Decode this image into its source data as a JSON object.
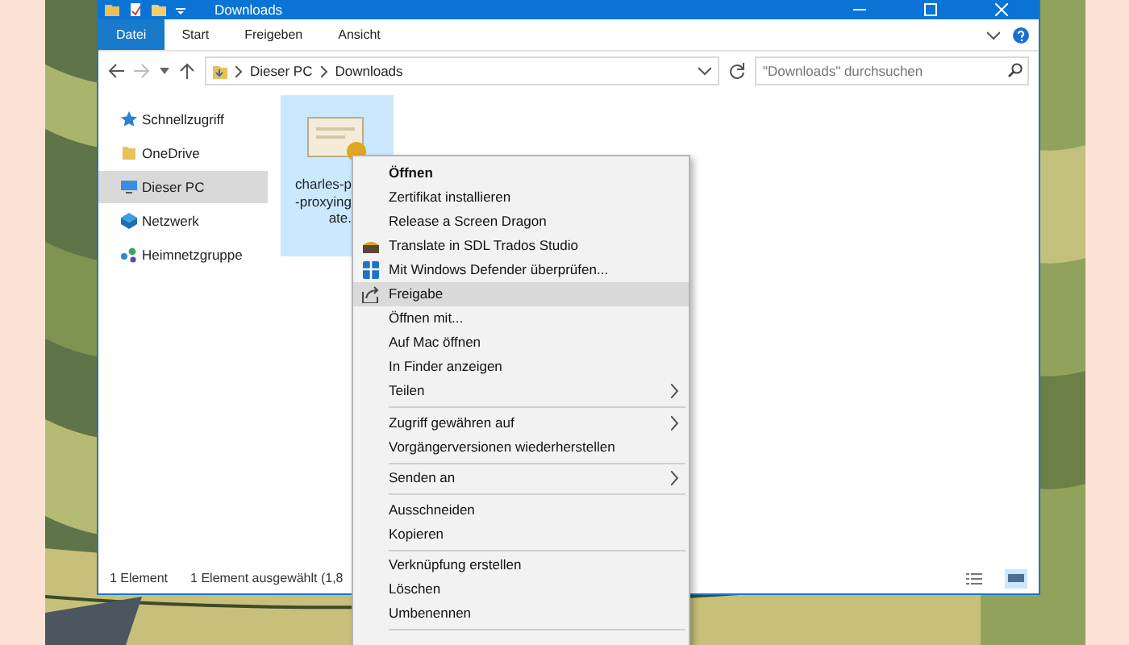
{
  "window": {
    "title": "Downloads"
  },
  "ribbon_tabs": [
    {
      "label": "Datei",
      "selected": true
    },
    {
      "label": "Start",
      "selected": false
    },
    {
      "label": "Freigeben",
      "selected": false
    },
    {
      "label": "Ansicht",
      "selected": false
    }
  ],
  "address_bar": {
    "path": [
      "Dieser PC",
      "Downloads"
    ]
  },
  "search": {
    "placeholder": "\"Downloads\" durchsuchen"
  },
  "sidebar": {
    "items": [
      {
        "label": "Schnellzugriff",
        "kind": "star",
        "selected": false
      },
      {
        "label": "OneDrive",
        "kind": "folder",
        "selected": false
      },
      {
        "label": "Dieser PC",
        "kind": "pc",
        "selected": true
      },
      {
        "label": "Netzwerk",
        "kind": "network",
        "selected": false
      },
      {
        "label": "Heimnetzgruppe",
        "kind": "homegroup",
        "selected": false
      }
    ]
  },
  "files": [
    {
      "name_lines": [
        "charles-p",
        "-proxying",
        "ate."
      ],
      "selected": true
    }
  ],
  "status_bar": {
    "count": "1 Element",
    "selection": "1 Element ausgewählt (1,8"
  },
  "context_menu": {
    "items": [
      {
        "kind": "item",
        "label": "Öffnen",
        "bold": true,
        "selected": false
      },
      {
        "kind": "item",
        "label": "Zertifikat installieren",
        "selected": false
      },
      {
        "kind": "item",
        "label": "Release a Screen Dragon",
        "selected": false
      },
      {
        "kind": "item",
        "label": "Translate in SDL Trados Studio",
        "selected": false
      },
      {
        "kind": "item",
        "label": "Mit Windows Defender überprüfen...",
        "selected": false
      },
      {
        "kind": "item",
        "label": "Freigabe",
        "selected": true
      },
      {
        "kind": "item",
        "label": "Öffnen mit...",
        "selected": false
      },
      {
        "kind": "item",
        "label": "Auf Mac öffnen",
        "selected": false
      },
      {
        "kind": "item",
        "label": "In Finder anzeigen",
        "selected": false
      },
      {
        "kind": "item",
        "label": "Teilen",
        "submenu": true,
        "selected": false
      },
      {
        "kind": "separator"
      },
      {
        "kind": "item",
        "label": "Zugriff gewähren auf",
        "submenu": true,
        "selected": false
      },
      {
        "kind": "item",
        "label": "Vorgängerversionen wiederherstellen",
        "selected": false
      },
      {
        "kind": "separator"
      },
      {
        "kind": "item",
        "label": "Senden an",
        "submenu": true,
        "selected": false
      },
      {
        "kind": "separator"
      },
      {
        "kind": "item",
        "label": "Ausschneiden",
        "selected": false
      },
      {
        "kind": "item",
        "label": "Kopieren",
        "selected": false
      },
      {
        "kind": "separator"
      },
      {
        "kind": "item",
        "label": "Verknüpfung erstellen",
        "selected": false
      },
      {
        "kind": "item",
        "label": "Löschen",
        "selected": false
      },
      {
        "kind": "item",
        "label": "Umbenennen",
        "selected": false
      },
      {
        "kind": "separator"
      }
    ]
  }
}
